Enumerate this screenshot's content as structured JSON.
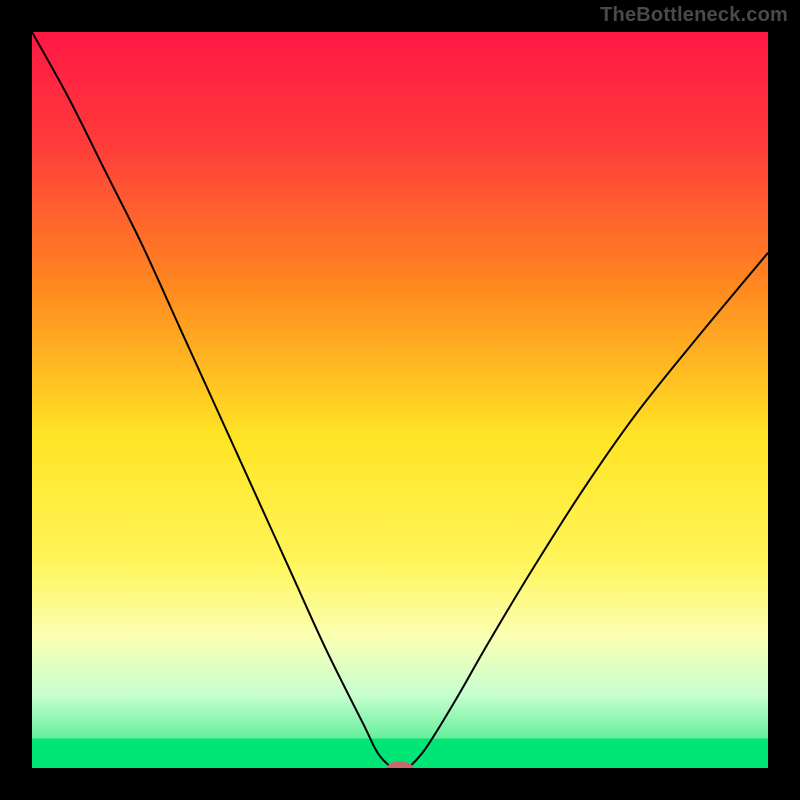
{
  "watermark": "TheBottleneck.com",
  "chart_data": {
    "type": "line",
    "title": "",
    "xlabel": "",
    "ylabel": "",
    "xlim": [
      0,
      100
    ],
    "ylim": [
      0,
      100
    ],
    "background_gradient_stops": [
      {
        "offset": 0.0,
        "color": "#ff1744"
      },
      {
        "offset": 0.15,
        "color": "#ff3b3b"
      },
      {
        "offset": 0.35,
        "color": "#ff8a1f"
      },
      {
        "offset": 0.55,
        "color": "#ffe424"
      },
      {
        "offset": 0.72,
        "color": "#fff55a"
      },
      {
        "offset": 0.82,
        "color": "#fbffb2"
      },
      {
        "offset": 0.9,
        "color": "#c8ffd0"
      },
      {
        "offset": 0.955,
        "color": "#6ef0a0"
      },
      {
        "offset": 1.0,
        "color": "#00e676"
      }
    ],
    "series": [
      {
        "name": "bottleneck-curve",
        "color": "#000000",
        "stroke_width": 2,
        "x": [
          0,
          5,
          10,
          15,
          20,
          25,
          30,
          35,
          40,
          45,
          47,
          49,
          50,
          51,
          53,
          55,
          58,
          62,
          68,
          75,
          82,
          90,
          100
        ],
        "y": [
          100,
          91,
          81,
          71,
          60,
          49,
          38,
          27,
          16,
          6,
          2,
          0,
          0,
          0,
          2,
          5,
          10,
          17,
          27,
          38,
          48,
          58,
          70
        ]
      }
    ],
    "marker": {
      "name": "optimal-point",
      "x": 50,
      "y": 0,
      "rx": 10,
      "ry": 5,
      "color": "#c96a6a"
    },
    "green_band": {
      "y_from": 0,
      "y_to": 4
    }
  }
}
